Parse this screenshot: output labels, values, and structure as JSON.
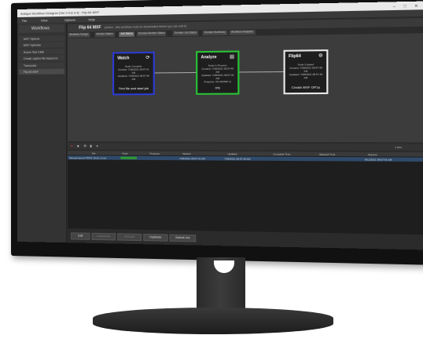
{
  "window": {
    "title": "Antique Workflow Designer [Ver 0.9.8.3.4] - Flip-64 MXF",
    "min": "–",
    "max": "□",
    "close": "✕"
  },
  "menu": [
    "File",
    "View",
    "Options",
    "Help"
  ],
  "sidebar": {
    "header": "Workflows",
    "items": [
      {
        "label": "MXF Options"
      },
      {
        "label": "MXF Optimize"
      },
      {
        "label": "Scene Test CMD"
      },
      {
        "label": "Create captive file based on"
      },
      {
        "label": "Transcode"
      },
      {
        "label": "Flip 64 MXF"
      }
    ]
  },
  "main": {
    "title": "Flip 64 MXF",
    "subtitle": "(Active - this workflow must be deactivated before you can edit it)",
    "tabs": [
      "Workflow Design",
      "Monitor Status",
      "Job Status",
      "Domain Monitor Status",
      "Domain Job Status",
      "Domain Summary",
      "Workflow Analytics"
    ],
    "active_tab": 2
  },
  "nodes": [
    {
      "title": "Watch",
      "icon": "⟳",
      "lines": [
        "Node Complete",
        "Created: 7/28/2021 08:57:41 AM",
        "Updated: 7/28/2021 08:57:46 AM"
      ],
      "footer": "Find file and start job",
      "color": "#2a3bd6"
    },
    {
      "title": "Analyze",
      "icon": "▤",
      "lines": [
        "Node In Process",
        "Created: 7/28/2021 08:57:46 AM",
        "Updated: 7/28/2021 08:57:46 AM",
        "Progress: 3/4 (WORK 1)"
      ],
      "footer": "0%",
      "color": "#29c436"
    },
    {
      "title": "Flip64",
      "icon": "⚙",
      "lines": [
        "Node Created",
        "Created: 7/28/2021 08:57:46 AM",
        "Updated: 7/28/2021 08:57:46 AM"
      ],
      "footer": "Create MXF OP1a",
      "color": "#e8e8e8"
    }
  ],
  "toolbar": {
    "count": "1 item"
  },
  "grid": {
    "columns": [
      "Job",
      "Node",
      "Progress",
      "Started",
      "Updated",
      "Complete Time",
      "Elapsed Time",
      "Expires"
    ],
    "rows": [
      {
        "job": "Manual launch FIRST_RUN_4.mxf",
        "node": "Analyze",
        "progress": "",
        "started": "7/28/2021 08:57:41 AM",
        "updated": "7/28/2021 08:57:46 AM",
        "complete": "",
        "elapsed": "",
        "expires": "8/11/2021 08:57:41 AM"
      }
    ]
  },
  "bottom_buttons": [
    {
      "label": "Edit",
      "enabled": true
    },
    {
      "label": "Deactivate",
      "enabled": false
    },
    {
      "label": "Activate",
      "enabled": false
    },
    {
      "label": "Duplicate",
      "enabled": true
    },
    {
      "label": "Submit Job",
      "enabled": true
    }
  ]
}
